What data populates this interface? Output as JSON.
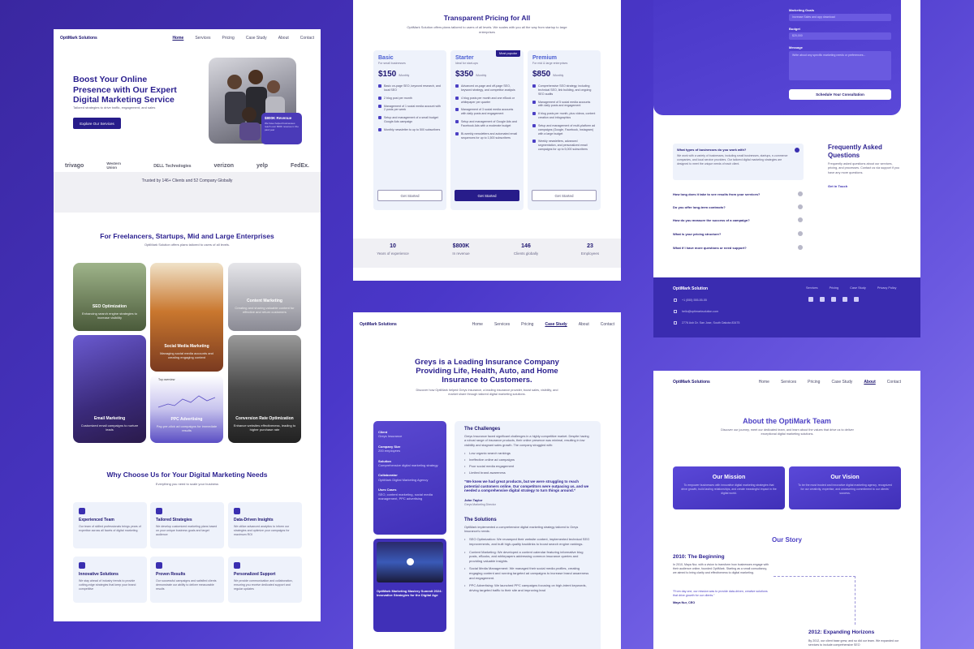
{
  "home": {
    "nav": {
      "logo": "OptiMark Solutions",
      "links": [
        "Home",
        "Services",
        "Pricing",
        "Case Study",
        "About",
        "Contact"
      ]
    },
    "hero": {
      "title": "Boost Your Online Presence with Our Expert Digital Marketing Service",
      "subtitle": "Tailored strategies to drive traffic, engagement, and sales",
      "cta": "Explore Our Services",
      "badge_value": "$800K Revenue",
      "badge_text": "We have helped businesses reach over 800K revenue in the past year"
    },
    "trusted": "Trusted by 146+ Clients and 52 Company Globally",
    "logos": [
      "trivago",
      "Western Union",
      "DELL Technologies",
      "verizon",
      "yelp",
      "FedEx."
    ],
    "services_title": "For Freelancers, Startups, Mid and Large Enterprises",
    "services_sub": "OptiMark Solution offers plans tailored to users of all levels.",
    "services": [
      {
        "title": "SEO Optimization",
        "desc": "Enhancing search engine strategies to increase visibility",
        "color": "#557a55"
      },
      {
        "title": "Social Media Marketing",
        "desc": "Managing social media accounts and creating engaging content",
        "color": "#a9662a"
      },
      {
        "title": "Content Marketing",
        "desc": "Creating and sharing valuable content for effective and return customers",
        "color": "#8e8e98"
      },
      {
        "title": "Email Marketing",
        "desc": "Customized email campaigns to nurture leads",
        "color": "#5a3e8a"
      },
      {
        "title": "PPC Advertising",
        "desc": "Pay-per-click ad campaigns for immediate results",
        "color": "#6a60c8"
      },
      {
        "title": "Conversion Rate Optimization",
        "desc": "Enhance websites effectiveness, leading to higher purchase rate",
        "color": "#4a4a4a"
      }
    ],
    "graph_label": "Top overview",
    "why_title": "Why Choose Us for Your Digital Marketing Needs",
    "why_sub": "Everything you need to scale your business",
    "why": [
      {
        "title": "Experienced Team",
        "desc": "Our team of skilled professionals brings years of expertise across all facets of digital marketing"
      },
      {
        "title": "Tailored Strategies",
        "desc": "We develop customized marketing plans based on your unique business goals and target audience"
      },
      {
        "title": "Data-Driven Insights",
        "desc": "We utilize advanced analytics to inform our strategies and optimize your campaigns for maximum ROI"
      },
      {
        "title": "Innovative Solutions",
        "desc": "We stay ahead of industry trends to provide cutting-edge strategies that keep your brand competitive"
      },
      {
        "title": "Proven Results",
        "desc": "Our successful campaigns and satisfied clients demonstrate our ability to deliver measurable results"
      },
      {
        "title": "Personalized Support",
        "desc": "We provide communication and collaboration, ensuring you receive dedicated support and regular updates"
      }
    ]
  },
  "pricing": {
    "title": "Transparent Pricing for All",
    "sub": "OptiMark Solution offers plans tailored to users of all levels. We scales with you all the way from startup to large enterprises",
    "plans": [
      {
        "name": "Basic",
        "tag": "For small businesses",
        "price": "$150",
        "per": "/Monthly",
        "button": "Get Started",
        "features": [
          "Basic on-page SEO, keyword research, and local SEO",
          "2 blog post per month",
          "Management of 1 social media account with 2 posts per week",
          "Setup and management of a small budget Google Ads campaign",
          "Monthly newsletter to up to 500 subscribers"
        ]
      },
      {
        "name": "Starter",
        "tag": "Ideal for start-ups",
        "price": "$350",
        "per": "/Monthly",
        "button": "Get Started",
        "badge": "Most popular",
        "features": [
          "Advanced on-page and off-page SEO, keyword strategy, and competitor analysis",
          "4 blog posts per month and one eBook or whitepaper per quarter",
          "Management of 3 social media accounts with daily posts and engagement",
          "Setup and management of Google Ads and Facebook Ads with a moderate budget",
          "Bi-weekly newsletters and automated email sequences for up to 1,500 subscribers"
        ]
      },
      {
        "name": "Premium",
        "tag": "For mid & large enterprises",
        "price": "$850",
        "per": "/Monthly",
        "button": "Get Started",
        "features": [
          "Comprehensive SEO strategy, including technical SEO, link building, and ongoing SEO audits",
          "Management of 5 social media accounts with daily posts and engagement",
          "8 blog posts per month, plus videos, content creation and infographics",
          "Setup and management of multi-platform ad campaigns (Google, Facebook, Instagram) with a large budget",
          "Weekly newsletters, advanced segmentation, and personalized email campaigns for up to 5,000 subscribers"
        ]
      }
    ],
    "stats": [
      {
        "value": "10",
        "label": "Years of experience"
      },
      {
        "value": "$800K",
        "label": "In revenue"
      },
      {
        "value": "146",
        "label": "Clients globally"
      },
      {
        "value": "23",
        "label": "Employees"
      }
    ]
  },
  "contact": {
    "fields": [
      {
        "label": "Marketing Goals",
        "value": "Increase Sales and app download"
      },
      {
        "label": "Budget",
        "value": "$20,000"
      },
      {
        "label": "Message",
        "value": "Write about any specific marketing needs or preferences..."
      }
    ],
    "button": "Schedule Your Consultation",
    "faq_title": "Frequently Asked Questions",
    "faq_sub": "Frequently asked questions about our services, pricing, and processes. Contact us via support if you have any more questions.",
    "faq_link": "Get in Touch",
    "faq_open": {
      "q": "What types of businesses do you work with?",
      "a": "We work with a variety of businesses, including small businesses, startups, e-commerce companies, and local service providers. Our tailored digital marketing strategies are designed to meet the unique needs of each client."
    },
    "faqs": [
      "How long does it take to see results from your services?",
      "Do you offer long-term contracts?",
      "How do you measure the success of a campaign?",
      "What is your pricing structure?",
      "What if I have more questions or need support?"
    ]
  },
  "footer": {
    "logo": "OptiMark Solution",
    "links": [
      "Services",
      "Pricing",
      "Case Study",
      "Privacy Policy"
    ],
    "phone": "+1 (555) 555-55-55",
    "email": "hello@optimarksolution.com",
    "address": "2776 Ash Dr. San Jose, South Dakota 83475"
  },
  "case": {
    "nav": {
      "logo": "OptiMark Solutions",
      "links": [
        "Home",
        "Services",
        "Pricing",
        "Case Study",
        "About",
        "Contact"
      ]
    },
    "title": "Greys is a Leading Insurance Company Providing Life, Health, Auto, and Home Insurance to Customers.",
    "sub": "Discover how OptiMark helped Greys Insurance, a leading insurance provider, boost sales, visibility, and market share through tailored digital marketing solutions.",
    "side": [
      {
        "label": "Client",
        "value": "Greys Insurance"
      },
      {
        "label": "Company Size",
        "value": "200 employees"
      },
      {
        "label": "Solution",
        "value": "Comprehensive digital marketing strategy"
      },
      {
        "label": "Collaborator",
        "value": "OptiMark Digital Marketing Agency"
      },
      {
        "label": "Uses Cases",
        "value": "SEO, content marketing, social media management, PPC advertising"
      }
    ],
    "video_caption": "OptiMark Marketing Mastery Summit 2024: Innovative Strategies for the Digital Age",
    "challenges_title": "The Challenges",
    "challenges_text": "Greys Insurance faced significant challenges in a highly competitive market. Despite having a robust range of insurance products, their online presence was minimal, resulting in low visibility and stagnant sales growth. The company struggled with:",
    "challenges": [
      "Low organic search rankings",
      "Ineffective online ad campaigns",
      "Poor social media engagement",
      "Limited brand awareness"
    ],
    "quote": "“We knew we had great products, but we were struggling to reach potential customers online. Our competitors were outpacing us, and we needed a comprehensive digital strategy to turn things around.”",
    "quote_name": "John Taylor",
    "quote_role": "Greys Marketing Director",
    "solutions_title": "The Solutions",
    "solutions_text": "OptiMark implemented a comprehensive digital marketing strategy tailored to Greys Insurance's needs:",
    "solutions": [
      "SEO Optimization: We revamped their website content, implemented technical SEO improvements, and built high-quality backlinks to boost search engine rankings.",
      "Content Marketing: We developed a content calendar featuring informative blog posts, eBooks, and whitepapers addressing common insurance queries and providing valuable insights.",
      "Social Media Management: We managed their social media profiles, creating engaging content and running targeted ad campaigns to increase brand awareness and engagement.",
      "PPC Advertising: We launched PPC campaigns focusing on high-intent keywords, driving targeted traffic to their site and improving lead"
    ]
  },
  "about": {
    "nav": {
      "logo": "OptiMark Solutions",
      "links": [
        "Home",
        "Services",
        "Pricing",
        "Case Study",
        "About",
        "Contact"
      ]
    },
    "title": "About the OptiMark Team",
    "sub": "Discover our journey, meet our dedicated team, and learn about the values that drive us to deliver exceptional digital marketing solutions.",
    "mission_title": "Our Mission",
    "mission_text": "To empower businesses with innovative digital marketing strategies that drive growth, build lasting relationships, and create meaningful impact in the digital world.",
    "vision_title": "Our Vision",
    "vision_text": "To be the most trusted and innovative digital marketing agency, recognized for our creativity, expertise, and unwavering commitment to our clients' success.",
    "story_title": "Our Story",
    "t1_title": "2010: The Beginning",
    "t1_text": "In 2010, Maya Nur, with a vision to transform how businesses engage with their audience online, founded OptiMark. Starting as a small consultancy, we aimed to bring clarity and effectiveness to digital marketing.",
    "t1_quote": "“From day one, our mission was to provide data-driven, creative solutions that drive growth for our clients.”",
    "t1_author": "Maya Nur, CEO",
    "t2_title": "2012: Expanding Horizons",
    "t2_text": "By 2012, our client base grew, and so did our team. We expanded our services to include comprehensive SEO"
  }
}
